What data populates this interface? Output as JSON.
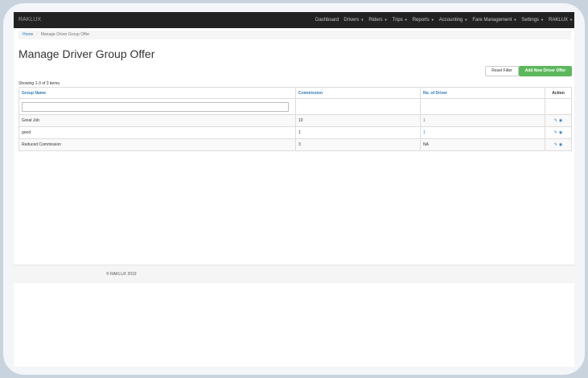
{
  "navbar": {
    "brand": "RAKLUX",
    "items": [
      {
        "label": "Dashboard",
        "dropdown": false
      },
      {
        "label": "Drivers",
        "dropdown": true
      },
      {
        "label": "Riders",
        "dropdown": true
      },
      {
        "label": "Trips",
        "dropdown": true
      },
      {
        "label": "Reports",
        "dropdown": true
      },
      {
        "label": "Accounting",
        "dropdown": true
      },
      {
        "label": "Fare Management",
        "dropdown": true
      },
      {
        "label": "Settings",
        "dropdown": true
      },
      {
        "label": "RAKLUX",
        "dropdown": true
      }
    ]
  },
  "breadcrumb": {
    "home": "Home",
    "separator": "/",
    "current": "Manage Driver Group Offer"
  },
  "page": {
    "title": "Manage Driver Group Offer"
  },
  "toolbar": {
    "reset_label": "Reset Filter",
    "add_label": "Add New Driver Offer"
  },
  "summary": "Showing 1-3 of 3 items.",
  "table": {
    "headers": {
      "group_name": "Group Name",
      "commission": "Commission",
      "drivers": "No. of Driver",
      "action": "Action"
    },
    "rows": [
      {
        "group_name": "Great Job",
        "commission": "10",
        "drivers": "1"
      },
      {
        "group_name": "good",
        "commission": "1",
        "drivers": "1"
      },
      {
        "group_name": "Reduced Commission",
        "commission": "3",
        "drivers": "NA"
      }
    ]
  },
  "icons": {
    "edit": "pencil-icon",
    "view": "eye-icon"
  },
  "colors": {
    "navbar": "#222222",
    "link": "#337ab7",
    "success": "#5cb85c"
  },
  "footer": {
    "text": "© RAKLUX 2019"
  }
}
